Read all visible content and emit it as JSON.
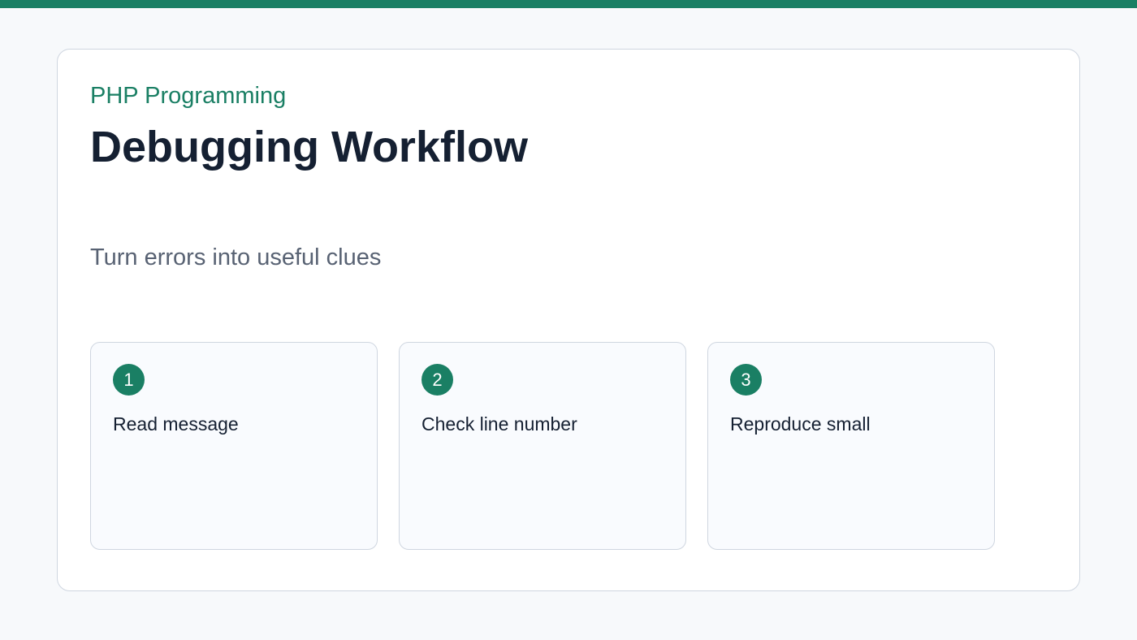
{
  "header": {
    "eyebrow": "PHP Programming",
    "title": "Debugging Workflow",
    "subtitle": "Turn errors into useful clues"
  },
  "steps": [
    {
      "number": "1",
      "label": "Read message"
    },
    {
      "number": "2",
      "label": "Check line number"
    },
    {
      "number": "3",
      "label": "Reproduce small"
    }
  ],
  "colors": {
    "accent": "#1a7f64",
    "heading": "#152032",
    "muted_text": "#586273",
    "border": "#cfd6e0",
    "page_background": "#f7f9fb",
    "card_background": "#ffffff"
  }
}
